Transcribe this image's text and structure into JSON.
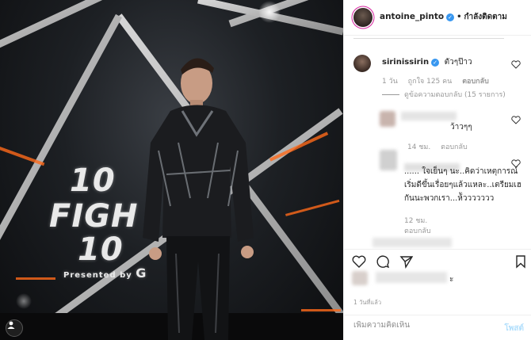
{
  "header": {
    "username": "antoine_pinto",
    "verified_icon": "verified-badge-icon",
    "separator": "•",
    "follow_label": "กำลังติดตาม"
  },
  "photo": {
    "logo_line1": "10",
    "logo_line2": "FIGH",
    "logo_line3": "10",
    "presented_by": "Presented by",
    "brand_fragment": "G"
  },
  "comments": {
    "first": {
      "username": "sirinissirin",
      "text": "ตัวๆป๊าว",
      "time": "1 วัน",
      "likes": "ถูกใจ 125 คน",
      "reply_label": "ตอบกลับ",
      "view_replies": "ดูข้อความตอบกลับ (15 รายการ)"
    },
    "reply1": {
      "text": "ว้าวๆๆ",
      "time": "14 ชม.",
      "reply_label": "ตอบกลับ"
    },
    "reply2": {
      "text": "...... ใจเย็นๆ นะ..คิดว่าเหตุการณ์เริ่มดีขึ้นเรื่อยๆแล้วแหละ..เตรียมเฮกันนะพวกเรา...ห้ัววววววว",
      "time": "12 ชม.",
      "reply_label": "ตอบกลับ"
    }
  },
  "likes": {
    "tail_text": "ะ"
  },
  "post_time": "1 วันที่แล้ว",
  "add_comment": {
    "placeholder": "เพิ่มความคิดเห็น",
    "post_label": "โพสต์"
  },
  "colors": {
    "accent": "#3897f0",
    "post_disabled": "#b2dffc",
    "meta_gray": "#999999"
  }
}
